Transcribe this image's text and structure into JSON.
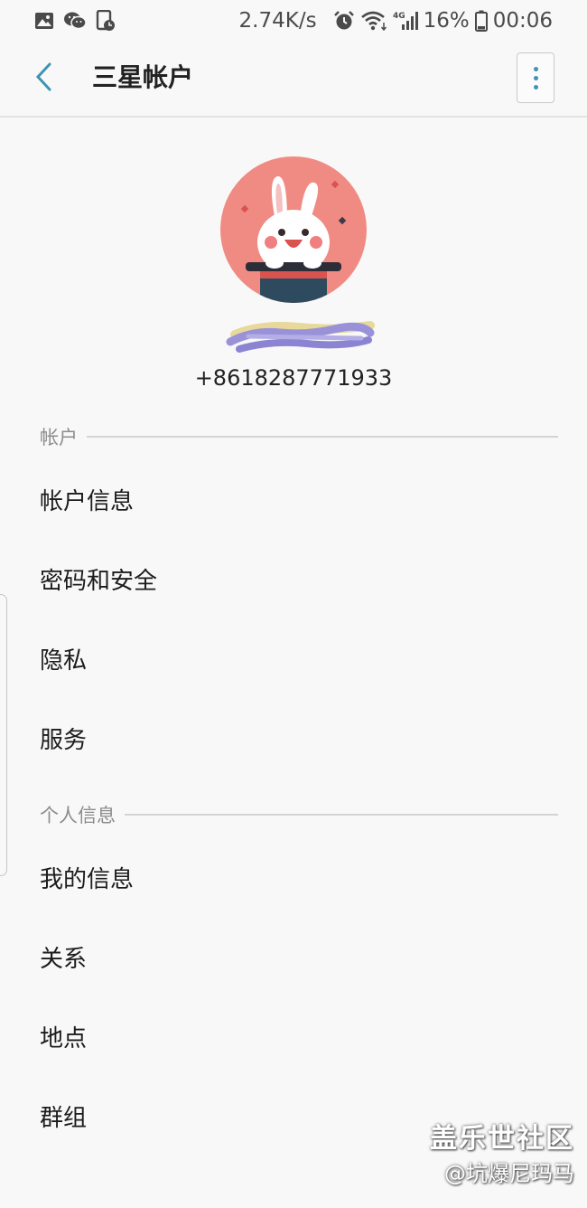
{
  "status_bar": {
    "network_speed": "2.74K/s",
    "network_type": "4G",
    "battery": "16%",
    "time": "00:06",
    "left_icons": [
      "gallery-icon",
      "wechat-icon",
      "screen-record-icon"
    ],
    "right_icons": [
      "alarm-icon",
      "wifi-icon",
      "signal-icon",
      "battery-icon"
    ]
  },
  "app_bar": {
    "title": "三星帐户",
    "back_icon": "chevron-left-icon",
    "more_icon": "more-vertical-icon"
  },
  "profile": {
    "avatar_icon": "rabbit-magic-hat-avatar",
    "name": "",
    "phone": "+8618287771933"
  },
  "sections": [
    {
      "label": "帐户",
      "items": [
        {
          "label": "帐户信息"
        },
        {
          "label": "密码和安全"
        },
        {
          "label": "隐私"
        },
        {
          "label": "服务"
        }
      ]
    },
    {
      "label": "个人信息",
      "items": [
        {
          "label": "我的信息"
        },
        {
          "label": "关系"
        },
        {
          "label": "地点"
        },
        {
          "label": "群组"
        }
      ]
    }
  ],
  "watermark": {
    "title": "盖乐世社区",
    "subtitle": "@坑爆尼玛马"
  },
  "colors": {
    "background": "#f8f8f8",
    "accent": "#3f93b3",
    "avatar_bg": "#f08b84",
    "section_label": "#8c8c8c"
  }
}
